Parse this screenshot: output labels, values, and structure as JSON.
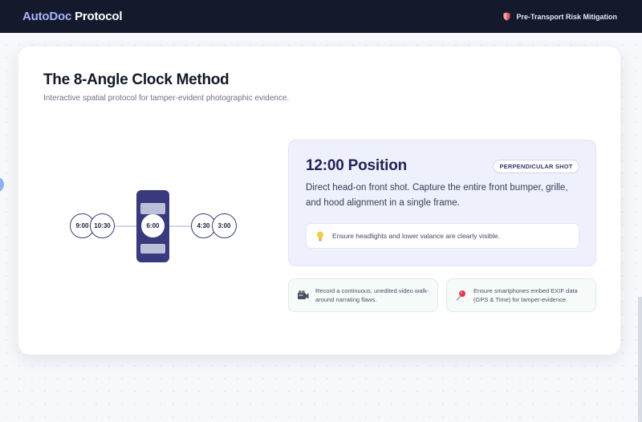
{
  "header": {
    "brand_part1": "AutoDoc",
    "brand_part2": "Protocol",
    "context_label": "Pre-Transport Risk Mitigation",
    "context_icon": "shield-icon"
  },
  "main": {
    "title": "The 8-Angle Clock Method",
    "subtitle": "Interactive spatial protocol for tamper-evident photographic evidence."
  },
  "diagram": {
    "positions": [
      "9:00",
      "10:30",
      "6:00",
      "4:30",
      "3:00"
    ],
    "active_position": "6:00",
    "vehicle_icon": "car-icon"
  },
  "detail": {
    "position_title": "12:00 Position",
    "shot_type": "PERPENDICULAR SHOT",
    "description": "Direct head-on front shot. Capture the entire front bumper, grille, and hood alignment in a single frame.",
    "tip_icon": "lightbulb-icon",
    "tip": "Ensure headlights and lower valance are clearly visible."
  },
  "notes": [
    {
      "icon": "video-camera-icon",
      "text": "Record a continuous, unedited video walk-around narrating flaws."
    },
    {
      "icon": "map-pin-icon",
      "text": "Ensure smartphones embed EXIF data (GPS & Time) for tamper-evidence."
    }
  ],
  "colors": {
    "header_bg": "#141a2c",
    "brand_accent": "#a9b4ff",
    "vehicle": "#39397e",
    "panel_bg": "#eef0fc",
    "note_bg": "#f6fbf9"
  }
}
